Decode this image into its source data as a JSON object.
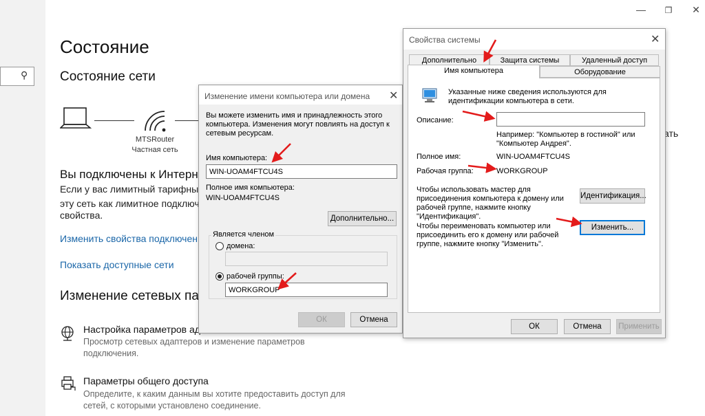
{
  "settings": {
    "page_title": "Состояние",
    "section_network": "Состояние сети",
    "router_name": "MTSRouter",
    "network_type": "Частная сеть",
    "connected": "Вы подключены к Интерн",
    "metered_line1": "Если у вас лимитный тарифный",
    "metered_line2": "эту сеть как лимитное подключ",
    "metered_line3": "свойства.",
    "link_change_props": "Изменить свойства подключен",
    "link_show_networks": "Показать доступные сети",
    "section_change": "Изменение сетевых пар",
    "items": [
      {
        "title": "Настройка параметров ад",
        "desc1": "Просмотр сетевых адаптеров и изменение параметров",
        "desc2": "подключения."
      },
      {
        "title": "Параметры общего доступа",
        "desc1": "Определите, к каким данным вы хотите предоставить доступ для",
        "desc2": "сетей, с которыми установлено соединение."
      }
    ],
    "cut_text_right": "ать"
  },
  "rename_dialog": {
    "title": "Изменение имени компьютера или домена",
    "intro": [
      "Вы можете изменить имя и принадлежность этого",
      "компьютера. Изменения могут повлиять на доступ к",
      "сетевым ресурсам."
    ],
    "computer_name_label": "Имя компьютера:",
    "computer_name_value": "WIN-UOAM4FTCU4S",
    "full_name_label": "Полное имя компьютера:",
    "full_name_value": "WIN-UOAM4FTCU4S",
    "more_button": "Дополнительно...",
    "member_of_label": "Является членом",
    "domain_label": "домена:",
    "domain_value": "",
    "workgroup_label": "рабочей группы:",
    "workgroup_value": "WORKGROUP",
    "ok_button": "ОК",
    "cancel_button": "Отмена"
  },
  "sysprops_dialog": {
    "title": "Свойства системы",
    "tabs_row1": [
      "Дополнительно",
      "Защита системы",
      "Удаленный доступ"
    ],
    "tabs_row2": [
      "Имя компьютера",
      "Оборудование"
    ],
    "active_tab": "Имя компьютера",
    "info_text": [
      "Указанные ниже сведения используются для",
      "идентификации компьютера в сети."
    ],
    "description_label": "Описание:",
    "description_value": "",
    "example_text": [
      "Например: \"Компьютер в гостиной\" или",
      "\"Компьютер Андрея\"."
    ],
    "full_name_label": "Полное имя:",
    "full_name_value": "WIN-UOAM4FTCU4S",
    "workgroup_label": "Рабочая группа:",
    "workgroup_value": "WORKGROUP",
    "wizard_text": [
      "Чтобы использовать мастер для",
      "присоединения компьютера к домену или",
      "рабочей группе, нажмите кнопку",
      "\"Идентификация\"."
    ],
    "identify_button": "Идентификация...",
    "rename_text": [
      "Чтобы переименовать компьютер или",
      "присоединить его к домену или рабочей",
      "группе, нажмите кнопку \"Изменить\"."
    ],
    "change_button": "Изменить...",
    "ok_button": "ОК",
    "cancel_button": "Отмена",
    "apply_button": "Применить"
  },
  "colors": {
    "link": "#1a66a8",
    "accent": "#0078d7",
    "arrow": "#e31b1b"
  }
}
